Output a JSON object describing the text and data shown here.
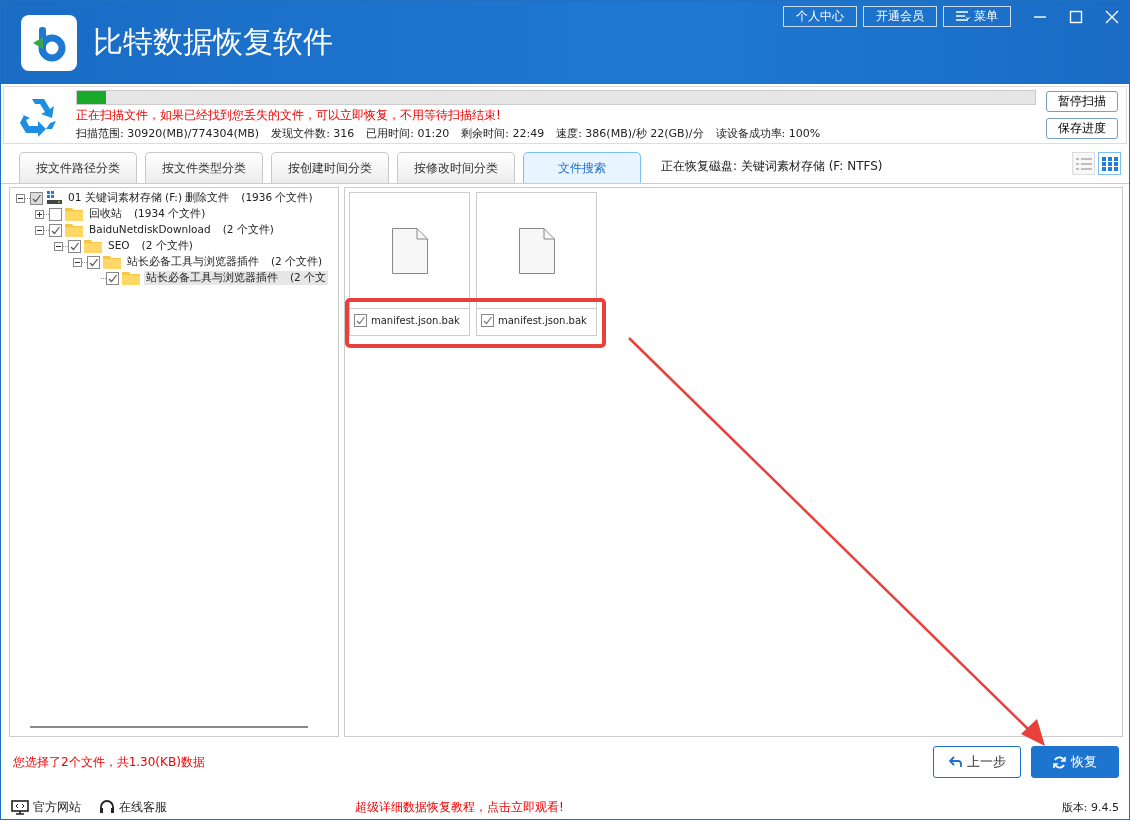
{
  "window": {
    "title": "比特数据恢复软件",
    "header_buttons": [
      {
        "label": "个人中心",
        "kind": "plain"
      },
      {
        "label": "开通会员",
        "kind": "plain"
      },
      {
        "label": "菜单",
        "kind": "menu"
      }
    ]
  },
  "scan": {
    "level": 0.03,
    "message": "正在扫描文件，如果已经找到您丢失的文件，可以立即恢复，不用等待扫描结束!",
    "stats": [
      "扫描范围: 30920(MB)/774304(MB)",
      "发现文件数: 316",
      "已用时间: 01:20",
      "剩余时间: 22:49",
      "速度: 386(MB)/秒  22(GB)/分",
      "读设备成功率: 100%"
    ],
    "buttons": [
      "暂停扫描",
      "保存进度"
    ]
  },
  "tabs": [
    {
      "label": "按文件路径分类",
      "selected": false
    },
    {
      "label": "按文件类型分类",
      "selected": false
    },
    {
      "label": "按创建时间分类",
      "selected": false
    },
    {
      "label": "按修改时间分类",
      "selected": false
    },
    {
      "label": "文件搜索",
      "selected": true
    }
  ],
  "disk_label": "正在恢复磁盘: 关键词素材存储 (F: NTFS)",
  "view_modes": [
    {
      "kind": "list",
      "selected": false
    },
    {
      "kind": "grid",
      "selected": true
    }
  ],
  "tree": [
    {
      "kind": "drive",
      "name": "01 关键词素材存储 (F:) 删除文件",
      "count": "(1936 个文件)",
      "checked": true,
      "expanded": true,
      "selected": false,
      "children": [
        {
          "kind": "folder",
          "name": "回收站",
          "count": "(1934 个文件)",
          "checked": false,
          "expanded": false,
          "selected": false
        },
        {
          "kind": "folder",
          "name": "BaiduNetdiskDownload",
          "count": "(2 个文件)",
          "checked": true,
          "expanded": true,
          "selected": false,
          "children": [
            {
              "kind": "folder",
              "name": "SEO",
              "count": "(2 个文件)",
              "checked": true,
              "expanded": true,
              "selected": false,
              "children": [
                {
                  "kind": "folder",
                  "name": "站长必备工具与浏览器插件",
                  "count": "(2 个文件)",
                  "checked": true,
                  "expanded": true,
                  "selected": false,
                  "children": [
                    {
                      "kind": "folder",
                      "name": "站长必备工具与浏览器插件",
                      "count": "(2 个文",
                      "checked": true,
                      "selected": true
                    }
                  ]
                }
              ]
            }
          ]
        }
      ]
    }
  ],
  "files": [
    {
      "name": "manifest.json.bak",
      "checked": true
    },
    {
      "name": "manifest.json.bak",
      "checked": true
    }
  ],
  "selection_summary": "您选择了2个文件，共1.30(KB)数据",
  "actions": [
    {
      "label": "上一步",
      "kind": "back"
    },
    {
      "label": "恢复",
      "kind": "recover"
    }
  ],
  "footer": {
    "links": [
      {
        "label": "官方网站",
        "kind": "website"
      },
      {
        "label": "在线客服",
        "kind": "support"
      }
    ],
    "promo": "超级详细数据恢复教程，点击立即观看!",
    "version": "版本: 9.4.5"
  }
}
